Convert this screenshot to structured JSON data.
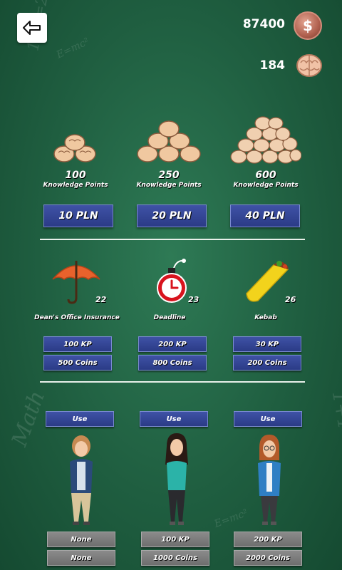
{
  "header": {
    "coins": "87400",
    "knowledge": "184",
    "coin_symbol": "$"
  },
  "packs": [
    {
      "amount": "100",
      "label": "Knowledge Points",
      "price": "10 PLN"
    },
    {
      "amount": "250",
      "label": "Knowledge Points",
      "price": "20 PLN"
    },
    {
      "amount": "600",
      "label": "Knowledge Points",
      "price": "40 PLN"
    }
  ],
  "items": [
    {
      "name": "Dean's Office Insurance",
      "count": "22",
      "kp_price": "100 KP",
      "coin_price": "500 Coins",
      "icon": "umbrella-icon"
    },
    {
      "name": "Deadline",
      "count": "23",
      "kp_price": "200 KP",
      "coin_price": "800 Coins",
      "icon": "bomb-clock-icon"
    },
    {
      "name": "Kebab",
      "count": "26",
      "kp_price": "30 KP",
      "coin_price": "200 Coins",
      "icon": "kebab-icon"
    }
  ],
  "characters": [
    {
      "use_label": "Use",
      "kp_price": "None",
      "coin_price": "None"
    },
    {
      "use_label": "Use",
      "kp_price": "100 KP",
      "coin_price": "1000 Coins"
    },
    {
      "use_label": "Use",
      "kp_price": "200 KP",
      "coin_price": "2000 Coins"
    }
  ],
  "colors": {
    "button_blue": "#33449a",
    "button_grey": "#7b7b7b",
    "chalkboard": "#1f5e40"
  }
}
